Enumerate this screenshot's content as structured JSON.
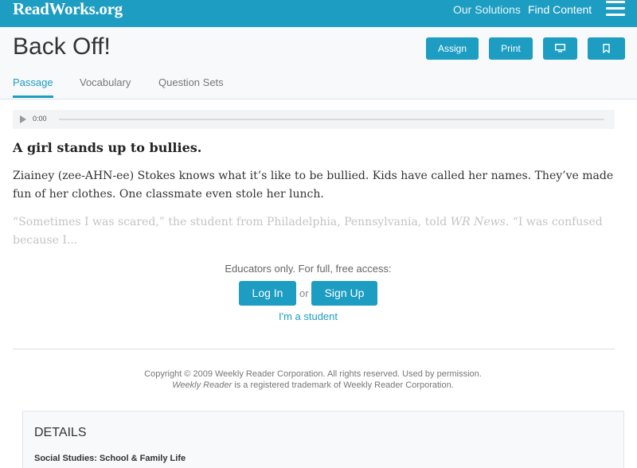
{
  "topbar": {
    "logo": "ReadWorks.org",
    "nav_solutions": "Our Solutions",
    "nav_find": "Find Content"
  },
  "header": {
    "title": "Back Off!",
    "assign_label": "Assign",
    "print_label": "Print",
    "present_icon": "monitor-icon",
    "bookmark_icon": "bookmark-icon"
  },
  "tabs": [
    {
      "label": "Passage",
      "active": true
    },
    {
      "label": "Vocabulary",
      "active": false
    },
    {
      "label": "Question Sets",
      "active": false
    }
  ],
  "audio": {
    "time": "0:00"
  },
  "article": {
    "headline": "A girl stands up to bullies.",
    "para1": "Ziainey (zee-AHN-ee) Stokes knows what it’s like to be bullied. Kids have called her names. They’ve made fun of her clothes. One classmate even stole her lunch.",
    "para2_before": "“Sometimes I was scared,” the student from Philadelphia, Pennsylvania, told ",
    "para2_em": "WR News",
    "para2_after": ". “I was confused because I..."
  },
  "access_gate": {
    "message": "Educators only. For full, free access:",
    "login_label": "Log In",
    "or_text": "or",
    "signup_label": "Sign Up",
    "student_link": "I'm a student"
  },
  "copyright": {
    "line1": "Copyright © 2009 Weekly Reader Corporation. All rights reserved. Used by permission.",
    "line2_em": "Weekly Reader",
    "line2_rest": " is a registered trademark of Weekly Reader Corporation."
  },
  "details": {
    "title": "DETAILS",
    "subject": "Social Studies: School & Family Life"
  },
  "colors": {
    "brand": "#1d9dc2",
    "header_bg": "#f7f9fa"
  }
}
